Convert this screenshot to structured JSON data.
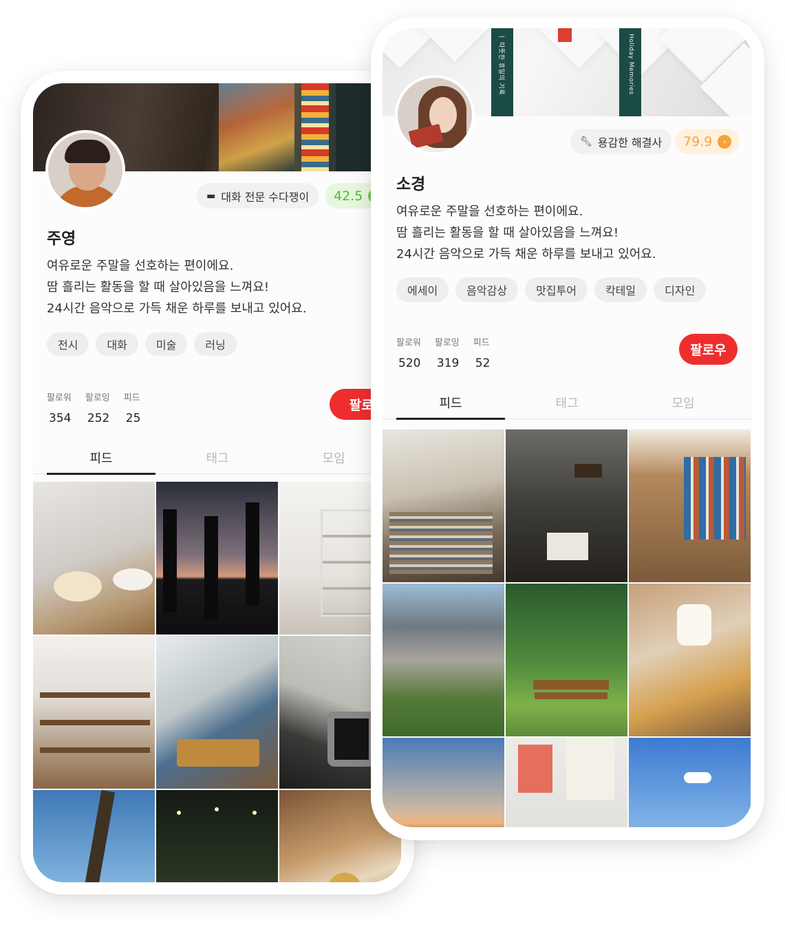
{
  "profiles": [
    {
      "name": "주영",
      "badge": {
        "icon": "chat-bubble-icon",
        "label": "대화 전문 수다쟁이"
      },
      "score": {
        "value": "42.5",
        "color": "#53b83a"
      },
      "bio": [
        "여유로운 주말을 선호하는 편이에요.",
        "땀 흘리는 활동을 할 때 살아있음을 느껴요!",
        "24시간 음악으로 가득 채운 하루를 보내고 있어요."
      ],
      "tags": [
        "전시",
        "대화",
        "미술",
        "러닝"
      ],
      "stats": [
        {
          "label": "팔로워",
          "value": "354"
        },
        {
          "label": "팔로잉",
          "value": "252"
        },
        {
          "label": "피드",
          "value": "25"
        }
      ],
      "follow_label": "팔로우",
      "tabs": [
        "피드",
        "태그",
        "모임"
      ]
    },
    {
      "name": "소경",
      "badge": {
        "icon": "wrench-icon",
        "label": "용감한 해결사"
      },
      "score": {
        "value": "79.9",
        "color": "#f6a33b"
      },
      "bio": [
        "여유로운 주말을 선호하는 편이에요.",
        "땀 흘리는 활동을 할 때 살아있음을 느껴요!",
        "24시간 음악으로 가득 채운 하루를 보내고 있어요."
      ],
      "tags": [
        "에세이",
        "음악감상",
        "맛집투어",
        "칵테일",
        "디자인"
      ],
      "stats": [
        {
          "label": "팔로워",
          "value": "520"
        },
        {
          "label": "팔로잉",
          "value": "319"
        },
        {
          "label": "피드",
          "value": "52"
        }
      ],
      "follow_label": "팔로우",
      "tabs": [
        "피드",
        "태그",
        "모임"
      ],
      "cover_book_spines": [
        "ㅣ 따뜻한 휴일의 기록",
        "Holiday Memories"
      ]
    }
  ],
  "colors": {
    "follow_button": "#ee2e2e",
    "accent_green": "#53b83a",
    "accent_orange": "#f6a33b"
  }
}
